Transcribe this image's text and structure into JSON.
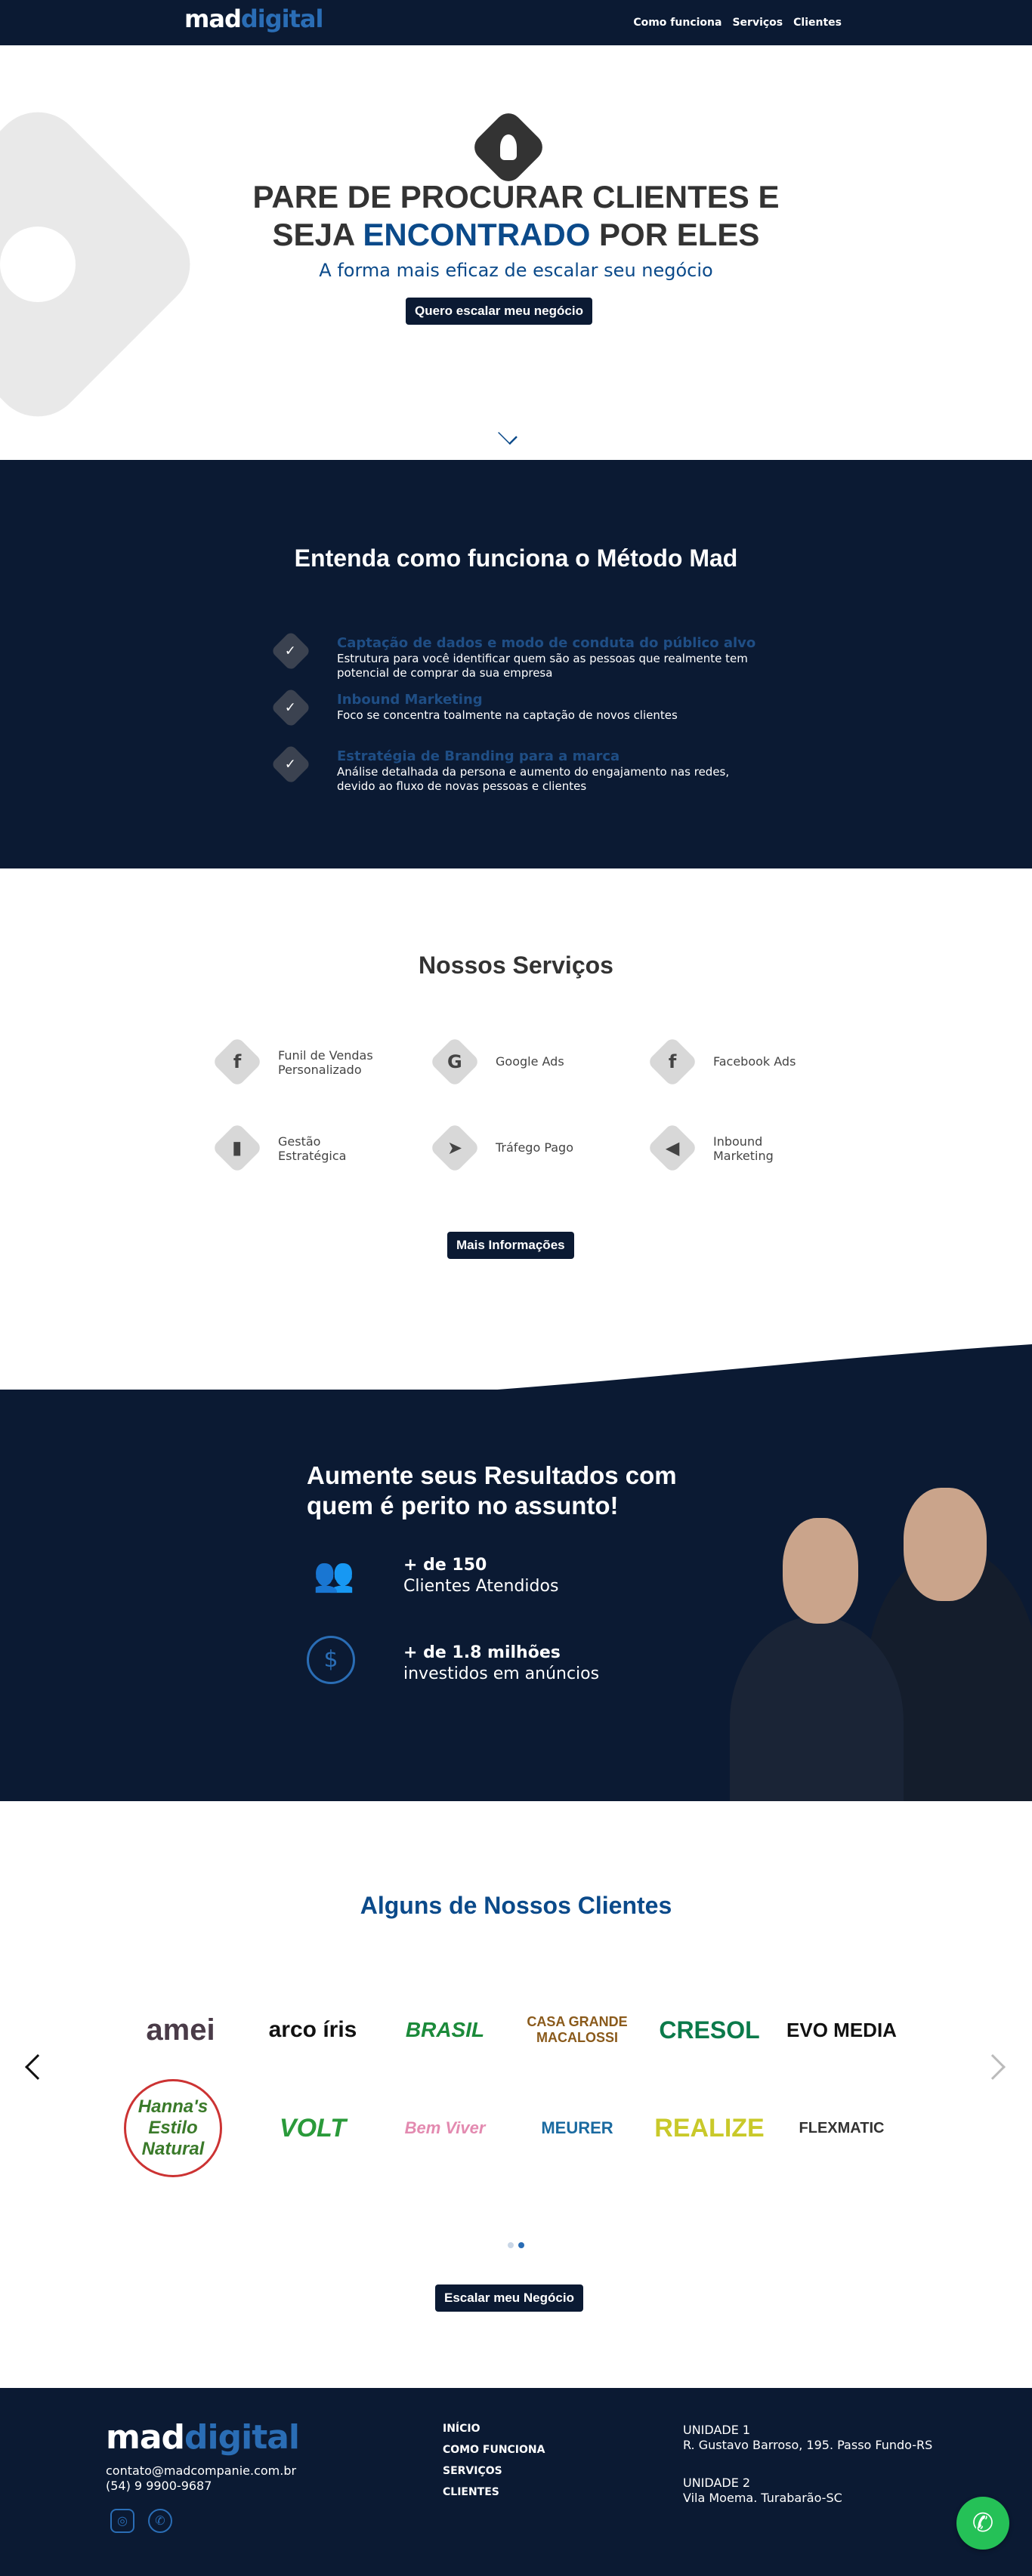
{
  "nav": {
    "logo_main": "mad",
    "logo_accent": "digital",
    "links": [
      "Como funciona",
      "Serviços",
      "Clientes"
    ]
  },
  "hero": {
    "title_line1": "PARE DE PROCURAR CLIENTES E",
    "title_line2_a": "SEJA ",
    "title_line2_b": "ENCONTRADO",
    "title_line2_c": " POR ELES",
    "subtitle": "A forma mais eficaz de escalar seu negócio",
    "cta": "Quero escalar meu negócio"
  },
  "metodo": {
    "title": "Entenda como funciona o Método Mad",
    "steps": [
      {
        "title": "Captação de dados e modo de conduta do público alvo",
        "desc": "Estrutura para você identificar quem são as pessoas que realmente tem potencial de comprar da sua empresa"
      },
      {
        "title": "Inbound Marketing",
        "desc": "Foco se concentra toalmente na captação de novos clientes"
      },
      {
        "title": "Estratégia de Branding para a marca",
        "desc": "Análise detalhada da persona e aumento do engajamento nas redes, devido ao fluxo de novas pessoas e clientes"
      }
    ]
  },
  "servicos": {
    "title": "Nossos Serviços",
    "items": [
      {
        "label": "Funil de Vendas Personalizado",
        "icon": "f"
      },
      {
        "label": "Google Ads",
        "icon": "G"
      },
      {
        "label": "Facebook Ads",
        "icon": "f"
      },
      {
        "label": "Gestão Estratégica",
        "icon": "▮"
      },
      {
        "label": "Tráfego Pago",
        "icon": "➤"
      },
      {
        "label": "Inbound Marketing",
        "icon": "◀"
      }
    ],
    "cta": "Mais Informações"
  },
  "resultados": {
    "title": "Aumente seus Resultados com quem é perito no assunto!",
    "stats": [
      {
        "number": "+ de 150",
        "caption": "Clientes Atendidos",
        "icon": "👥"
      },
      {
        "number": "+ de 1.8 milhões",
        "caption": "investidos em anúncios",
        "icon": "$"
      }
    ]
  },
  "clientes": {
    "title": "Alguns de Nossos Clientes",
    "logos": [
      "amei",
      "arco íris",
      "BRASIL",
      "CASA GRANDE MACALOSSI",
      "CRESOL",
      "EVO MEDIA",
      "Hanna's Estilo Natural",
      "VOLT",
      "Bem Viver",
      "MEURER",
      "REALIZE",
      "FLEXMATIC"
    ],
    "cta": "Escalar meu Negócio"
  },
  "footer": {
    "logo_main": "mad",
    "logo_accent": "digital",
    "email": "contato@madcompanie.com.br",
    "phone": "(54) 9 9900-9687",
    "menu": [
      "INÍCIO",
      "COMO FUNCIONA",
      "SERVIÇOS",
      "CLIENTES"
    ],
    "unit1_title": "UNIDADE 1",
    "unit1_addr": "R. Gustavo Barroso, 195. Passo Fundo-RS",
    "unit2_title": "UNIDADE 2",
    "unit2_addr": "Vila Moema. Turabarão-SC"
  },
  "colors": {
    "navy": "#0b1a33",
    "accent": "#0b4a8a",
    "light_blue": "#2a6db5",
    "whatsapp": "#25c157"
  }
}
